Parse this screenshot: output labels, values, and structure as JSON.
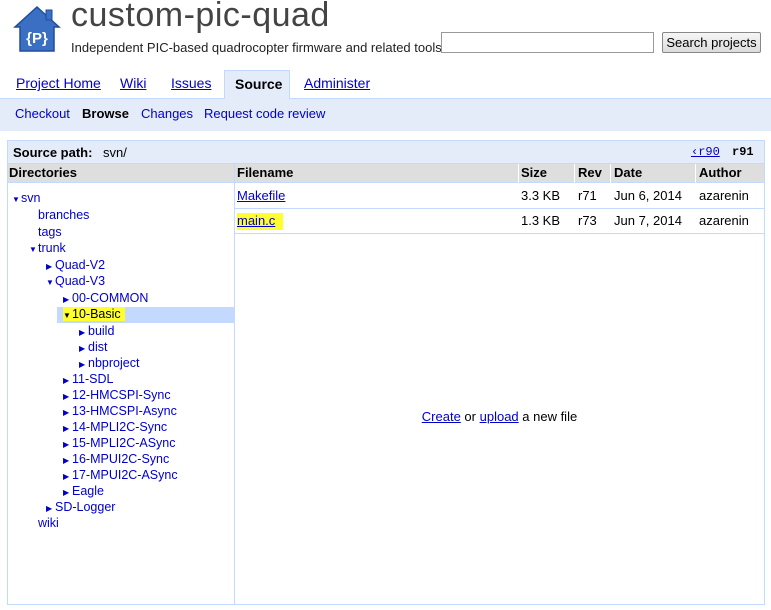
{
  "header": {
    "project_name": "custom-pic-quad",
    "summary": "Independent PIC-based quadrocopter firmware and related tools",
    "search_placeholder": "",
    "search_button": "Search projects",
    "logo_text": "{P}"
  },
  "tabs": [
    {
      "label": "Project Home",
      "active": false
    },
    {
      "label": "Wiki",
      "active": false
    },
    {
      "label": "Issues",
      "active": false
    },
    {
      "label": "Source",
      "active": true
    },
    {
      "label": "Administer",
      "active": false
    }
  ],
  "subtabs": [
    {
      "label": "Checkout",
      "current": false
    },
    {
      "label": "Browse",
      "current": true
    },
    {
      "label": "Changes",
      "current": false
    },
    {
      "label": "Request code review",
      "current": false
    }
  ],
  "source_path": {
    "label": "Source path:",
    "value": "svn/",
    "prev_rev": "‹r90",
    "current_rev": "r91"
  },
  "directories": {
    "header": "Directories",
    "nodes": [
      {
        "label": "svn",
        "expanded": true,
        "has_arrow": true
      },
      {
        "label": "branches",
        "has_arrow": false
      },
      {
        "label": "tags",
        "has_arrow": false
      },
      {
        "label": "trunk",
        "expanded": true,
        "has_arrow": true
      },
      {
        "label": "Quad-V2",
        "expanded": false,
        "has_arrow": true
      },
      {
        "label": "Quad-V3",
        "expanded": true,
        "has_arrow": true
      },
      {
        "label": "00-COMMON",
        "expanded": false,
        "has_arrow": true
      },
      {
        "label": "10-Basic",
        "expanded": true,
        "has_arrow": true,
        "selected": true
      },
      {
        "label": "build",
        "expanded": false,
        "has_arrow": true
      },
      {
        "label": "dist",
        "expanded": false,
        "has_arrow": true
      },
      {
        "label": "nbproject",
        "expanded": false,
        "has_arrow": true
      },
      {
        "label": "11-SDL",
        "expanded": false,
        "has_arrow": true
      },
      {
        "label": "12-HMCSPI-Sync",
        "expanded": false,
        "has_arrow": true
      },
      {
        "label": "13-HMCSPI-Async",
        "expanded": false,
        "has_arrow": true
      },
      {
        "label": "14-MPLI2C-Sync",
        "expanded": false,
        "has_arrow": true
      },
      {
        "label": "15-MPLI2C-ASync",
        "expanded": false,
        "has_arrow": true
      },
      {
        "label": "16-MPUI2C-Sync",
        "expanded": false,
        "has_arrow": true
      },
      {
        "label": "17-MPUI2C-ASync",
        "expanded": false,
        "has_arrow": true
      },
      {
        "label": "Eagle",
        "expanded": false,
        "has_arrow": true
      },
      {
        "label": "SD-Logger",
        "expanded": false,
        "has_arrow": true
      },
      {
        "label": "wiki",
        "has_arrow": false
      }
    ]
  },
  "files": {
    "columns": [
      "Filename",
      "Size",
      "Rev",
      "Date",
      "Author"
    ],
    "rows": [
      {
        "filename": "Makefile",
        "size": "3.3 KB",
        "rev": "r71",
        "date": "Jun 6, 2014",
        "author": "azarenin",
        "highlighted": false
      },
      {
        "filename": "main.c",
        "size": "1.3 KB",
        "rev": "r73",
        "date": "Jun 7, 2014",
        "author": "azarenin",
        "highlighted": true
      }
    ],
    "empty_create": "Create",
    "empty_or": " or ",
    "empty_upload": "upload",
    "empty_tail": " a new file"
  },
  "colors": {
    "tab_border": "#c3d9ff",
    "subtab_bg": "#e5ecf9",
    "link": "#0000cc",
    "highlight": "#ffff30"
  }
}
